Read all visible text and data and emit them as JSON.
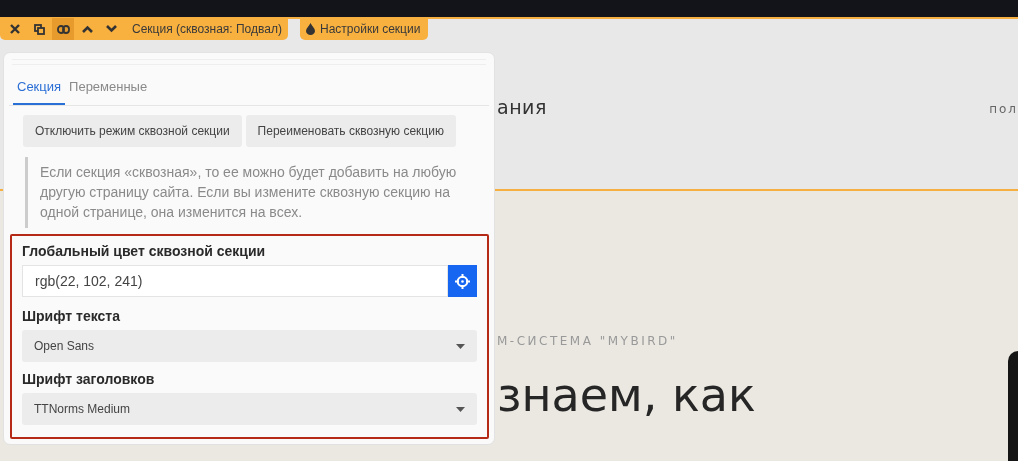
{
  "toolbar": {
    "tools": [
      {
        "kind": "close",
        "selected": false
      },
      {
        "kind": "duplicate",
        "selected": false
      },
      {
        "kind": "link",
        "selected": true
      },
      {
        "kind": "up",
        "selected": false
      },
      {
        "kind": "down",
        "selected": false
      }
    ],
    "section_label": "Секция (сквозная: Подвал)",
    "settings_button": "Настройки секции"
  },
  "panel": {
    "tabs": [
      {
        "label": "Секция",
        "selected": true
      },
      {
        "label": "Переменные",
        "selected": false
      }
    ],
    "buttons": [
      "Отключить режим сквозной секции",
      "Переименовать сквозную секцию"
    ],
    "note": "Если секция «сквозная», то ее можно будет добавить на любую другую страницу сайта. Если вы измените сквозную секцию на одной странице, она изменится на всех.",
    "global_color": {
      "label": "Глобальный цвет сквозной секции",
      "value": "rgb(22, 102, 241)"
    },
    "selects": [
      {
        "label": "Шрифт текста",
        "value": "Open Sans"
      },
      {
        "label": "Шрифт заголовков",
        "value": "TTNorms Medium"
      }
    ]
  },
  "page": {
    "header_text": "ания",
    "nav_item": "пол",
    "eyebrow": "М-СИСТЕМА \"MYBIRD\"",
    "headline": [
      "знаем, как"
    ]
  }
}
